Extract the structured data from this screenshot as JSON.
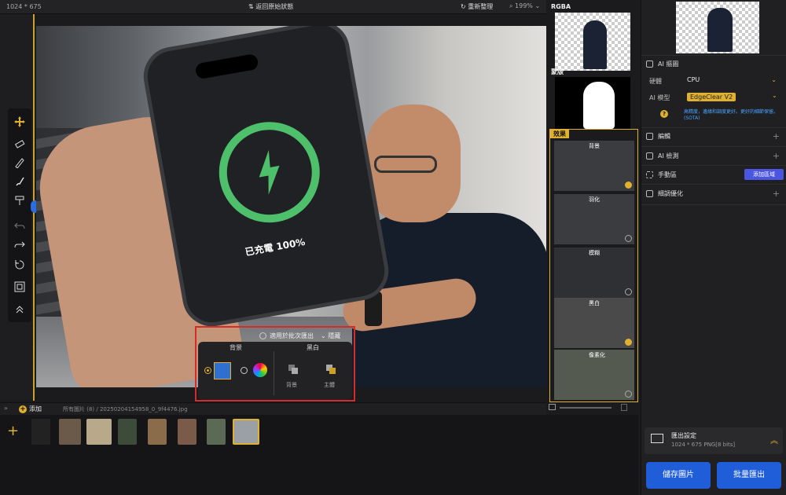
{
  "topbar": {
    "dims": "1024 * 675",
    "revert_label": "返回原始狀態",
    "reorganize_label": "重新整理",
    "zoom": "199%"
  },
  "canvas": {
    "phone_text": "已充電 100%"
  },
  "popup": {
    "apply_batch_label": "適用於批次匯出",
    "hide_label": "隱藏",
    "bg_header": "背景",
    "bw_header": "黑白",
    "bw_bg_label": "背景",
    "bw_subject_label": "主體"
  },
  "filmstrip": {
    "add_label": "添加",
    "all_images_label": "所有圖片 (8)",
    "path": "/ 20250204154958_0_9f4476.jpg"
  },
  "preview": {
    "rgba_label": "RGBA",
    "mask_label": "蒙版",
    "effects_label": "效果",
    "effects": [
      {
        "name": "背景",
        "checked": true
      },
      {
        "name": "羽化",
        "checked": false
      },
      {
        "name": "模糊",
        "checked": false
      },
      {
        "name": "黑白",
        "checked": true
      },
      {
        "name": "像素化",
        "checked": false
      }
    ]
  },
  "right_panel": {
    "ai_matting": "AI 摳圖",
    "hardware_label": "硬體",
    "hardware_value": "CPU",
    "ai_model_label": "AI 模型",
    "ai_model_value": "EdgeClear  V2",
    "model_hint": "高精度，邊緣和調度更好。更好的細節保留。(SOTA)",
    "edit_label": "編輯",
    "ai_detect_label": "AI 檢測",
    "manual_area_label": "手動區",
    "add_area_label": "添加區域",
    "refine_label": "細調優化",
    "export_title": "匯出設定",
    "export_info": "1024 * 675 PNG[8 bits]",
    "btn_left": "儲存圖片",
    "btn_right": "批量匯出"
  },
  "colors": {
    "accent": "#e0b030",
    "highlight_red": "#d42b2b",
    "primary_blue": "#1f5ed8"
  }
}
